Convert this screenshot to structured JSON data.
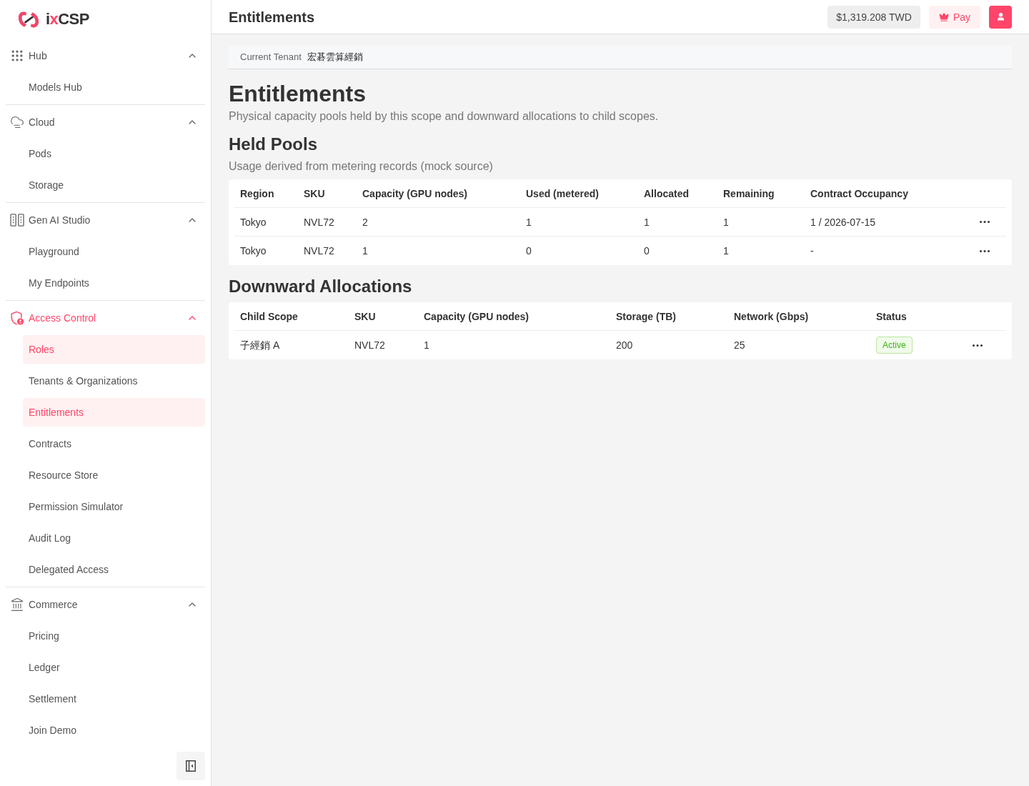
{
  "sidebar": {
    "logo": {
      "parts": [
        {
          "text": "i",
          "color": "#333333"
        },
        {
          "text": "x",
          "color": "#ff4569"
        },
        {
          "text": "CSP",
          "color": "#333333"
        }
      ]
    },
    "groups": [
      {
        "label": "Hub",
        "expanded": true,
        "selected": false,
        "items": [
          {
            "label": "Models Hub",
            "selected": false
          }
        ]
      },
      {
        "label": "Cloud",
        "expanded": true,
        "selected": false,
        "items": [
          {
            "label": "Pods",
            "selected": false
          },
          {
            "label": "Storage",
            "selected": false
          }
        ]
      },
      {
        "label": "Gen AI Studio",
        "expanded": true,
        "selected": false,
        "items": [
          {
            "label": "Playground",
            "selected": false
          },
          {
            "label": "My Endpoints",
            "selected": false
          }
        ]
      },
      {
        "label": "Access Control",
        "expanded": true,
        "selected": true,
        "items": [
          {
            "label": "Roles",
            "selected": true
          },
          {
            "label": "Tenants & Organizations",
            "selected": false
          },
          {
            "label": "Entitlements",
            "selected": true
          },
          {
            "label": "Contracts",
            "selected": false
          },
          {
            "label": "Resource Store",
            "selected": false
          },
          {
            "label": "Permission Simulator",
            "selected": false
          },
          {
            "label": "Audit Log",
            "selected": false
          },
          {
            "label": "Delegated Access",
            "selected": false
          }
        ]
      },
      {
        "label": "Commerce",
        "expanded": true,
        "selected": false,
        "items": [
          {
            "label": "Pricing",
            "selected": false
          },
          {
            "label": "Ledger",
            "selected": false
          },
          {
            "label": "Settlement",
            "selected": false
          },
          {
            "label": "Join Demo",
            "selected": false
          }
        ]
      }
    ]
  },
  "header": {
    "title": "Entitlements",
    "balance": "$1,319.208 TWD",
    "pay_button": "Pay"
  },
  "tenant": {
    "label": "Current Tenant",
    "value": "宏碁雲算經銷"
  },
  "page": {
    "title": "Entitlements",
    "subtitle": "Physical capacity pools held by this scope and downward allocations to child scopes."
  },
  "sections": [
    {
      "title": "Held Pools",
      "subtitle": "Usage derived from metering records (mock source)",
      "table": {
        "columns": [
          "Region",
          "SKU",
          "Capacity (GPU nodes)",
          "Used (metered)",
          "Allocated",
          "Remaining",
          "Contract Occupancy"
        ],
        "rows": [
          {
            "cells": [
              "Tokyo",
              "NVL72",
              "2",
              "1",
              "1",
              "1",
              "1 / 2026-07-15"
            ]
          },
          {
            "cells": [
              "Tokyo",
              "NVL72",
              "1",
              "0",
              "0",
              "1",
              "-"
            ]
          }
        ]
      }
    },
    {
      "title": "Downward Allocations",
      "table": {
        "columns": [
          "Child Scope",
          "SKU",
          "Capacity (GPU nodes)",
          "Storage (TB)",
          "Network (Gbps)",
          "Status"
        ],
        "rows": [
          {
            "cells": [
              "子經銷 A",
              "NVL72",
              "1",
              "200",
              "25"
            ],
            "status": {
              "label": "Active",
              "kind": "active"
            }
          }
        ]
      }
    }
  ]
}
